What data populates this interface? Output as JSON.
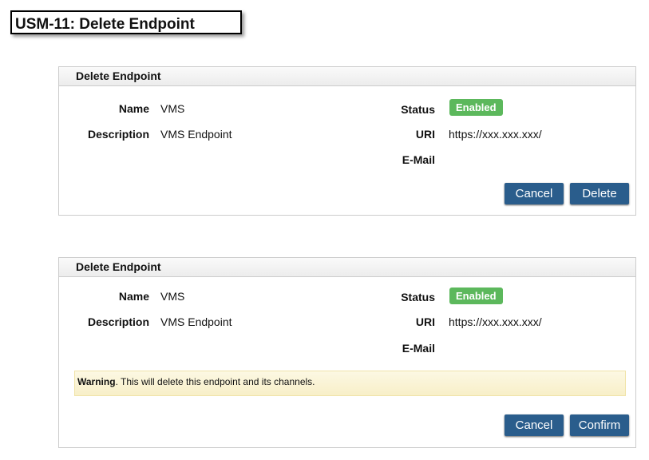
{
  "title": "USM-11: Delete Endpoint",
  "panels": [
    {
      "header": "Delete Endpoint",
      "name_label": "Name",
      "name": "VMS",
      "desc_label": "Description",
      "desc": "VMS Endpoint",
      "status_label": "Status",
      "status": "Enabled",
      "uri_label": "URI",
      "uri": "https://xxx.xxx.xxx/",
      "email_label": "E-Mail",
      "cancel": "Cancel",
      "action": "Delete"
    },
    {
      "header": "Delete Endpoint",
      "name_label": "Name",
      "name": "VMS",
      "desc_label": "Description",
      "desc": "VMS Endpoint",
      "status_label": "Status",
      "status": "Enabled",
      "uri_label": "URI",
      "uri": "https://xxx.xxx.xxx/",
      "email_label": "E-Mail",
      "warning_bold": "Warning",
      "warning_text": ". This will delete this endpoint and its channels.",
      "cancel": "Cancel",
      "action": "Confirm"
    }
  ],
  "colors": {
    "primary": "#2a5d8c",
    "success": "#5cb85c",
    "warning_bg": "#fcf8e3"
  }
}
